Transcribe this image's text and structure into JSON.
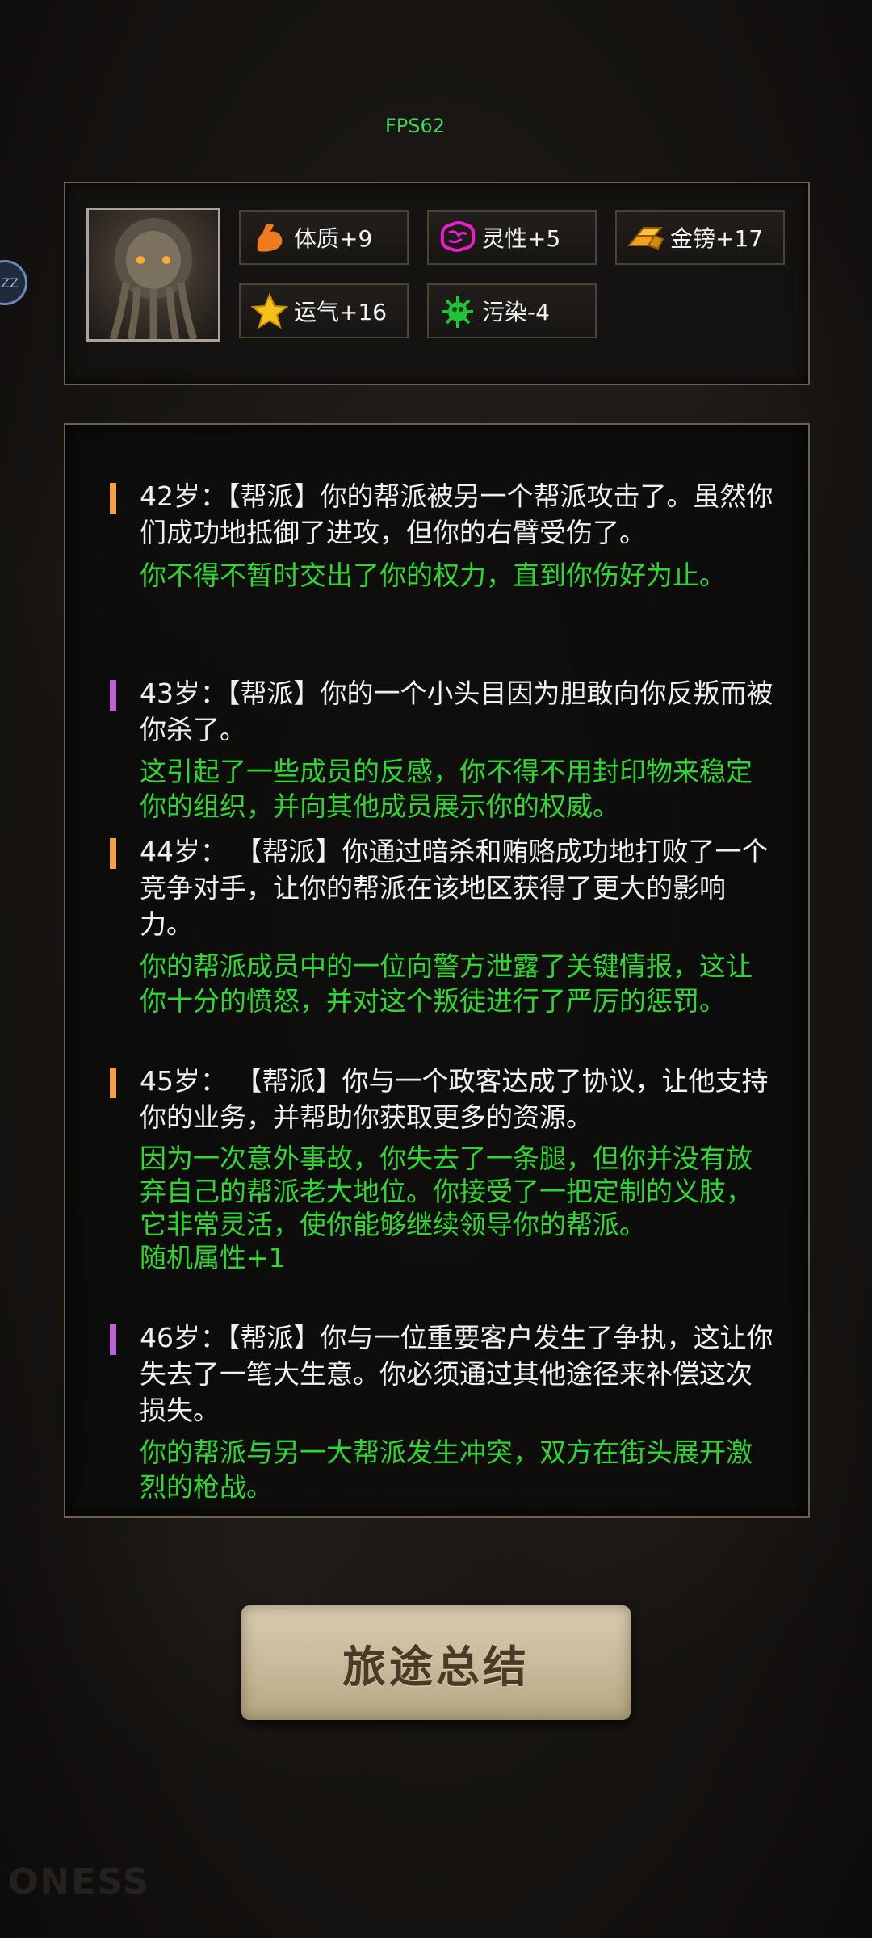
{
  "fps": "FPS62",
  "side_handle": "ZZ",
  "stats": [
    {
      "label": "体质+9",
      "icon": "muscle-arm-icon"
    },
    {
      "label": "灵性+5",
      "icon": "brain-icon"
    },
    {
      "label": "金镑+17",
      "icon": "gold-bars-icon"
    },
    {
      "label": "运气+16",
      "icon": "star-icon"
    },
    {
      "label": "污染-4",
      "icon": "virus-icon"
    }
  ],
  "log": [
    {
      "main": "42岁：【帮派】你的帮派被另一个帮派攻击了。虽然你们成功地抵御了进攻，但你的右臂受伤了。",
      "sub": "你不得不暂时交出了你的权力，直到你伤好为止。",
      "marker_color": "#f2a340"
    },
    {
      "main": "43岁：【帮派】你的一个小头目因为胆敢向你反叛而被你杀了。",
      "sub": "这引起了一些成员的反感，你不得不用封印物来稳定你的组织，并向其他成员展示你的权威。",
      "marker_color": "#c060d8"
    },
    {
      "main": "44岁： 【帮派】你通过暗杀和贿赂成功地打败了一个竞争对手，让你的帮派在该地区获得了更大的影响力。",
      "sub": "你的帮派成员中的一位向警方泄露了关键情报，这让你十分的愤怒，并对这个叛徒进行了严厉的惩罚。",
      "marker_color": "#f2a340"
    },
    {
      "main": "45岁： 【帮派】你与一个政客达成了协议，让他支持你的业务，并帮助你获取更多的资源。",
      "sub": "因为一次意外事故，你失去了一条腿，但你并没有放弃自己的帮派老大地位。你接受了一把定制的义肢，它非常灵活，使你能够继续领导你的帮派。",
      "extra": "随机属性+1",
      "marker_color": "#f2a340"
    },
    {
      "main": "46岁：【帮派】你与一位重要客户发生了争执，这让你失去了一笔大生意。你必须通过其他途径来补偿这次损失。",
      "sub": "你的帮派与另一大帮派发生冲突，双方在街头展开激烈的枪战。",
      "marker_color": "#c060d8"
    }
  ],
  "summary_button": "旅途总结",
  "watermark": "ONESS"
}
